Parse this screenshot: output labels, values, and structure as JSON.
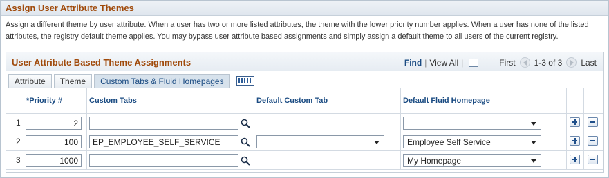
{
  "section": {
    "title": "Assign User Attribute Themes",
    "instructions": "Assign a different theme by user attribute. When a user has two or more listed attributes, the theme with the lower priority number applies. When a user has none of the listed attributes, the registry default theme applies. You may bypass user attribute based assignments and simply assign a default theme to all users of the current registry."
  },
  "grid": {
    "title": "User Attribute Based Theme Assignments",
    "nav": {
      "find": "Find",
      "view_all": "View All",
      "separator": "|",
      "first": "First",
      "range": "1-3 of 3",
      "last": "Last"
    },
    "tabs": [
      {
        "label": "Attribute"
      },
      {
        "label": "Theme"
      },
      {
        "label": "Custom Tabs & Fluid Homepages",
        "active": true
      }
    ],
    "columns": {
      "priority": "*Priority #",
      "custom_tabs": "Custom Tabs",
      "default_custom_tab": "Default Custom Tab",
      "default_fluid_homepage": "Default Fluid Homepage"
    },
    "rows": [
      {
        "num": "1",
        "priority": "2",
        "custom_tabs": "",
        "default_custom_tab": null,
        "default_fluid_homepage": ""
      },
      {
        "num": "2",
        "priority": "100",
        "custom_tabs": "EP_EMPLOYEE_SELF_SERVICE",
        "default_custom_tab": "",
        "default_fluid_homepage": "Employee Self Service"
      },
      {
        "num": "3",
        "priority": "1000",
        "custom_tabs": "",
        "default_custom_tab": null,
        "default_fluid_homepage": "My Homepage"
      }
    ]
  },
  "colors": {
    "title_text": "#a04a0b",
    "link": "#1a4b82",
    "header_bg": "#dfe6ee"
  },
  "icons": [
    "lookup-icon",
    "popout-icon",
    "show-all-tabs-icon",
    "previous-icon",
    "next-icon",
    "add-row-icon",
    "delete-row-icon",
    "dropdown-arrow-icon"
  ]
}
